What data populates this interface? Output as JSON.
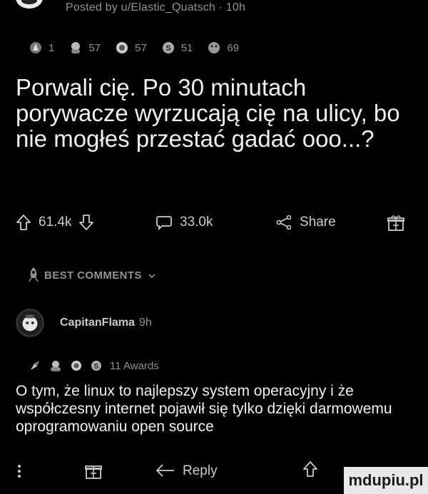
{
  "post": {
    "posted_by": "Posted by u/Elastic_Quatsch · 10h",
    "awards": [
      {
        "icon": "rocket-award-icon",
        "count": "1"
      },
      {
        "icon": "wholesome-award-icon",
        "count": "57"
      },
      {
        "icon": "helpful-award-icon",
        "count": "57"
      },
      {
        "icon": "silver-award-icon",
        "count": "51"
      },
      {
        "icon": "hugz-award-icon",
        "count": "69"
      }
    ],
    "title": "Porwali cię. Po 30 minutach porywacze wyrzucają cię na ulicy, bo nie mogłeś przestać gadać ooo...?",
    "upvotes": "61.4k",
    "comments": "33.0k",
    "share": "Share"
  },
  "sort": {
    "label": "BEST COMMENTS"
  },
  "comment": {
    "username": "CapitanFlama",
    "age": "9h",
    "awards_label": "11 Awards",
    "body": "O tym, że linux to najlepszy system operacyjny i że współczesny internet pojawił się tylko dzięki darmowemu oprogramowaniu open source",
    "reply": "Reply"
  },
  "watermark": "mdupiu.pl"
}
